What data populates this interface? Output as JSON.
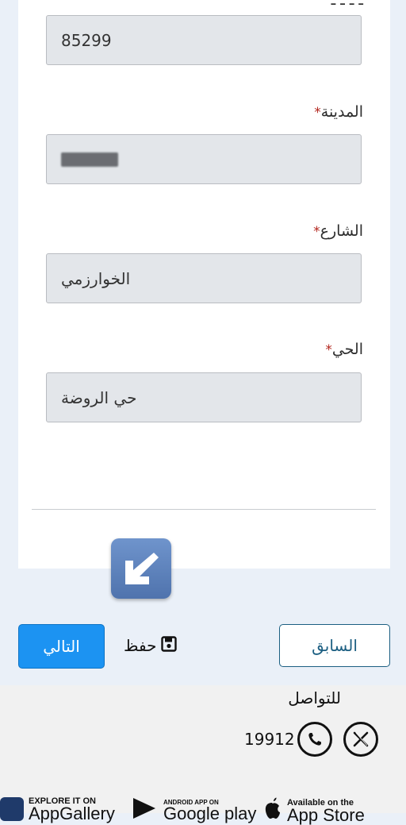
{
  "form": {
    "postal": {
      "value": "85299"
    },
    "city": {
      "label": "المدينة",
      "required_mark": "*"
    },
    "street": {
      "label": "الشارع",
      "required_mark": "*",
      "value": "الخوارزمي"
    },
    "district": {
      "label": "الحي",
      "required_mark": "*",
      "value": "حي الروضة"
    }
  },
  "actions": {
    "next_label": "التالي",
    "save_label": "حفظ",
    "prev_label": "السابق"
  },
  "footer": {
    "contact_title": "للتواصل",
    "phone_number": "19912",
    "stores": [
      {
        "small": "EXPLORE IT ON",
        "big": "AppGallery"
      },
      {
        "small": "ANDROID APP ON",
        "big": "Google play"
      },
      {
        "small": "Available on the",
        "big": "App Store"
      }
    ]
  },
  "colors": {
    "primary": "#1c93f2",
    "secondary_border": "#1c5f82",
    "required": "#b3261e"
  },
  "icons": [
    "arrow-down-left-icon",
    "save-icon",
    "phone-icon",
    "x-logo-icon"
  ]
}
